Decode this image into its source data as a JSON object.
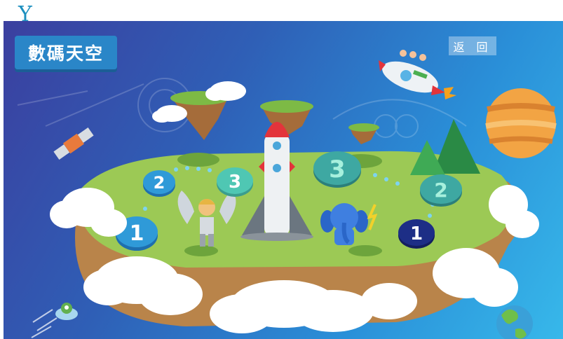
{
  "corner_link": {
    "label": "Y"
  },
  "app": {
    "title": "數碼天空"
  },
  "header": {
    "back_label": "返 回"
  },
  "levels": {
    "left": [
      {
        "label": "1",
        "color": "#2f9ad8"
      },
      {
        "label": "2",
        "color": "#2f9ad8"
      },
      {
        "label": "3",
        "color": "#4fc7b3"
      }
    ],
    "right": [
      {
        "label": "1",
        "color": "#1d2e86"
      },
      {
        "label": "2",
        "color": "#3ea8a2"
      },
      {
        "label": "3",
        "color": "#3ea8a2"
      }
    ]
  },
  "colors": {
    "island_grass": "#9cc955",
    "island_soil": "#b9844a",
    "rocket_nose": "#e3343b",
    "planet": "#f2a444"
  },
  "icons": [
    "satellite-icon",
    "rocket-ship-icon",
    "planet-icon",
    "earth-icon",
    "ufo-alien-icon",
    "angel-hero-icon",
    "elephant-mascot-icon",
    "cloud-icon",
    "floating-island-icon"
  ]
}
